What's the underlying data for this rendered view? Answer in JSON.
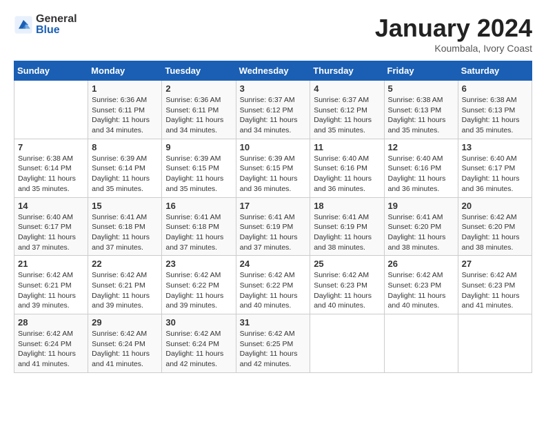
{
  "header": {
    "logo_general": "General",
    "logo_blue": "Blue",
    "month_title": "January 2024",
    "subtitle": "Koumbala, Ivory Coast"
  },
  "calendar": {
    "days_of_week": [
      "Sunday",
      "Monday",
      "Tuesday",
      "Wednesday",
      "Thursday",
      "Friday",
      "Saturday"
    ],
    "weeks": [
      [
        {
          "day": "",
          "sunrise": "",
          "sunset": "",
          "daylight": ""
        },
        {
          "day": "1",
          "sunrise": "Sunrise: 6:36 AM",
          "sunset": "Sunset: 6:11 PM",
          "daylight": "Daylight: 11 hours and 34 minutes."
        },
        {
          "day": "2",
          "sunrise": "Sunrise: 6:36 AM",
          "sunset": "Sunset: 6:11 PM",
          "daylight": "Daylight: 11 hours and 34 minutes."
        },
        {
          "day": "3",
          "sunrise": "Sunrise: 6:37 AM",
          "sunset": "Sunset: 6:12 PM",
          "daylight": "Daylight: 11 hours and 34 minutes."
        },
        {
          "day": "4",
          "sunrise": "Sunrise: 6:37 AM",
          "sunset": "Sunset: 6:12 PM",
          "daylight": "Daylight: 11 hours and 35 minutes."
        },
        {
          "day": "5",
          "sunrise": "Sunrise: 6:38 AM",
          "sunset": "Sunset: 6:13 PM",
          "daylight": "Daylight: 11 hours and 35 minutes."
        },
        {
          "day": "6",
          "sunrise": "Sunrise: 6:38 AM",
          "sunset": "Sunset: 6:13 PM",
          "daylight": "Daylight: 11 hours and 35 minutes."
        }
      ],
      [
        {
          "day": "7",
          "sunrise": "Sunrise: 6:38 AM",
          "sunset": "Sunset: 6:14 PM",
          "daylight": "Daylight: 11 hours and 35 minutes."
        },
        {
          "day": "8",
          "sunrise": "Sunrise: 6:39 AM",
          "sunset": "Sunset: 6:14 PM",
          "daylight": "Daylight: 11 hours and 35 minutes."
        },
        {
          "day": "9",
          "sunrise": "Sunrise: 6:39 AM",
          "sunset": "Sunset: 6:15 PM",
          "daylight": "Daylight: 11 hours and 35 minutes."
        },
        {
          "day": "10",
          "sunrise": "Sunrise: 6:39 AM",
          "sunset": "Sunset: 6:15 PM",
          "daylight": "Daylight: 11 hours and 36 minutes."
        },
        {
          "day": "11",
          "sunrise": "Sunrise: 6:40 AM",
          "sunset": "Sunset: 6:16 PM",
          "daylight": "Daylight: 11 hours and 36 minutes."
        },
        {
          "day": "12",
          "sunrise": "Sunrise: 6:40 AM",
          "sunset": "Sunset: 6:16 PM",
          "daylight": "Daylight: 11 hours and 36 minutes."
        },
        {
          "day": "13",
          "sunrise": "Sunrise: 6:40 AM",
          "sunset": "Sunset: 6:17 PM",
          "daylight": "Daylight: 11 hours and 36 minutes."
        }
      ],
      [
        {
          "day": "14",
          "sunrise": "Sunrise: 6:40 AM",
          "sunset": "Sunset: 6:17 PM",
          "daylight": "Daylight: 11 hours and 37 minutes."
        },
        {
          "day": "15",
          "sunrise": "Sunrise: 6:41 AM",
          "sunset": "Sunset: 6:18 PM",
          "daylight": "Daylight: 11 hours and 37 minutes."
        },
        {
          "day": "16",
          "sunrise": "Sunrise: 6:41 AM",
          "sunset": "Sunset: 6:18 PM",
          "daylight": "Daylight: 11 hours and 37 minutes."
        },
        {
          "day": "17",
          "sunrise": "Sunrise: 6:41 AM",
          "sunset": "Sunset: 6:19 PM",
          "daylight": "Daylight: 11 hours and 37 minutes."
        },
        {
          "day": "18",
          "sunrise": "Sunrise: 6:41 AM",
          "sunset": "Sunset: 6:19 PM",
          "daylight": "Daylight: 11 hours and 38 minutes."
        },
        {
          "day": "19",
          "sunrise": "Sunrise: 6:41 AM",
          "sunset": "Sunset: 6:20 PM",
          "daylight": "Daylight: 11 hours and 38 minutes."
        },
        {
          "day": "20",
          "sunrise": "Sunrise: 6:42 AM",
          "sunset": "Sunset: 6:20 PM",
          "daylight": "Daylight: 11 hours and 38 minutes."
        }
      ],
      [
        {
          "day": "21",
          "sunrise": "Sunrise: 6:42 AM",
          "sunset": "Sunset: 6:21 PM",
          "daylight": "Daylight: 11 hours and 39 minutes."
        },
        {
          "day": "22",
          "sunrise": "Sunrise: 6:42 AM",
          "sunset": "Sunset: 6:21 PM",
          "daylight": "Daylight: 11 hours and 39 minutes."
        },
        {
          "day": "23",
          "sunrise": "Sunrise: 6:42 AM",
          "sunset": "Sunset: 6:22 PM",
          "daylight": "Daylight: 11 hours and 39 minutes."
        },
        {
          "day": "24",
          "sunrise": "Sunrise: 6:42 AM",
          "sunset": "Sunset: 6:22 PM",
          "daylight": "Daylight: 11 hours and 40 minutes."
        },
        {
          "day": "25",
          "sunrise": "Sunrise: 6:42 AM",
          "sunset": "Sunset: 6:23 PM",
          "daylight": "Daylight: 11 hours and 40 minutes."
        },
        {
          "day": "26",
          "sunrise": "Sunrise: 6:42 AM",
          "sunset": "Sunset: 6:23 PM",
          "daylight": "Daylight: 11 hours and 40 minutes."
        },
        {
          "day": "27",
          "sunrise": "Sunrise: 6:42 AM",
          "sunset": "Sunset: 6:23 PM",
          "daylight": "Daylight: 11 hours and 41 minutes."
        }
      ],
      [
        {
          "day": "28",
          "sunrise": "Sunrise: 6:42 AM",
          "sunset": "Sunset: 6:24 PM",
          "daylight": "Daylight: 11 hours and 41 minutes."
        },
        {
          "day": "29",
          "sunrise": "Sunrise: 6:42 AM",
          "sunset": "Sunset: 6:24 PM",
          "daylight": "Daylight: 11 hours and 41 minutes."
        },
        {
          "day": "30",
          "sunrise": "Sunrise: 6:42 AM",
          "sunset": "Sunset: 6:24 PM",
          "daylight": "Daylight: 11 hours and 42 minutes."
        },
        {
          "day": "31",
          "sunrise": "Sunrise: 6:42 AM",
          "sunset": "Sunset: 6:25 PM",
          "daylight": "Daylight: 11 hours and 42 minutes."
        },
        {
          "day": "",
          "sunrise": "",
          "sunset": "",
          "daylight": ""
        },
        {
          "day": "",
          "sunrise": "",
          "sunset": "",
          "daylight": ""
        },
        {
          "day": "",
          "sunrise": "",
          "sunset": "",
          "daylight": ""
        }
      ]
    ]
  }
}
